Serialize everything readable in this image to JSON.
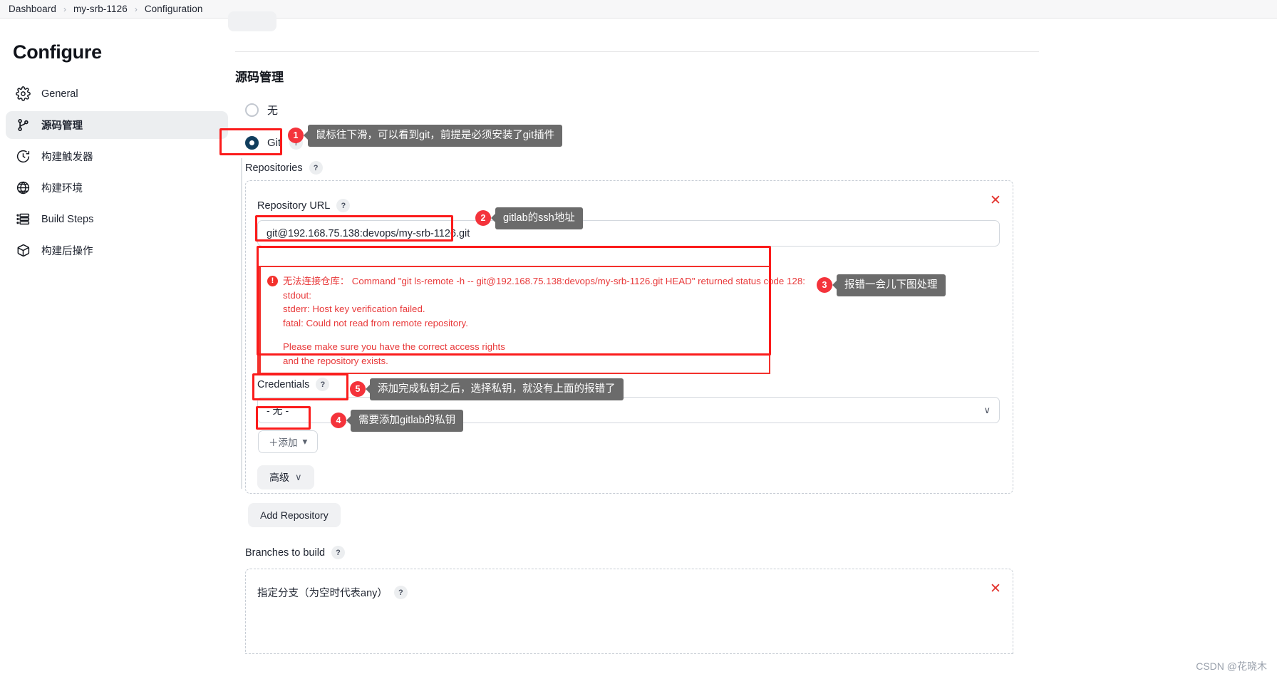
{
  "breadcrumb": {
    "items": [
      "Dashboard",
      "my-srb-1126",
      "Configuration"
    ],
    "separator": "›"
  },
  "sidebar": {
    "title": "Configure",
    "items": [
      {
        "label": "General",
        "icon": "gear-icon",
        "active": false
      },
      {
        "label": "源码管理",
        "icon": "branch-icon",
        "active": true
      },
      {
        "label": "构建触发器",
        "icon": "clock-icon",
        "active": false
      },
      {
        "label": "构建环境",
        "icon": "globe-icon",
        "active": false
      },
      {
        "label": "Build Steps",
        "icon": "list-icon",
        "active": false
      },
      {
        "label": "构建后操作",
        "icon": "box-icon",
        "active": false
      }
    ]
  },
  "main": {
    "section_title": "源码管理",
    "scm_options": [
      {
        "label": "无",
        "selected": false,
        "has_help": false
      },
      {
        "label": "Git",
        "selected": true,
        "has_help": true
      }
    ],
    "repositories_label": "Repositories",
    "repository_url_label": "Repository URL",
    "repository_url_value": "git@192.168.75.138:devops/my-srb-1126.git",
    "error": {
      "icon": "!",
      "line1": "无法连接仓库： Command \"git ls-remote -h -- git@192.168.75.138:devops/my-srb-1126.git HEAD\" returned status code 128:",
      "line2": "stdout:",
      "line3": "stderr: Host key verification failed.",
      "line4": "fatal: Could not read from remote repository.",
      "line5": "Please make sure you have the correct access rights",
      "line6": "and the repository exists."
    },
    "credentials_label": "Credentials",
    "credentials_value": "- 无 -",
    "add_credentials_button": "＋添加",
    "advanced_button": "高级",
    "add_repository_button": "Add Repository",
    "branches_label": "Branches to build",
    "branch_spec_label": "指定分支（为空时代表any）",
    "help_glyph": "?",
    "close_glyph": "✕",
    "chevron_glyph": "∨",
    "dropdown_caret": "▾"
  },
  "annotations": [
    {
      "num": "1",
      "text": "鼠标往下滑，可以看到git，前提是必须安装了git插件"
    },
    {
      "num": "2",
      "text": "gitlab的ssh地址"
    },
    {
      "num": "3",
      "text": "报错一会儿下图处理"
    },
    {
      "num": "4",
      "text": "需要添加gitlab的私钥"
    },
    {
      "num": "5",
      "text": "添加完成私钥之后，选择私钥，就没有上面的报错了"
    }
  ],
  "watermark": "CSDN @花晓木",
  "colors": {
    "annotation_red": "#f4333b",
    "highlight_red": "#fb1b1b",
    "error_red": "#e8393a",
    "bubble_gray": "#6b6b6b",
    "radio_selected": "#0f3c5c"
  }
}
